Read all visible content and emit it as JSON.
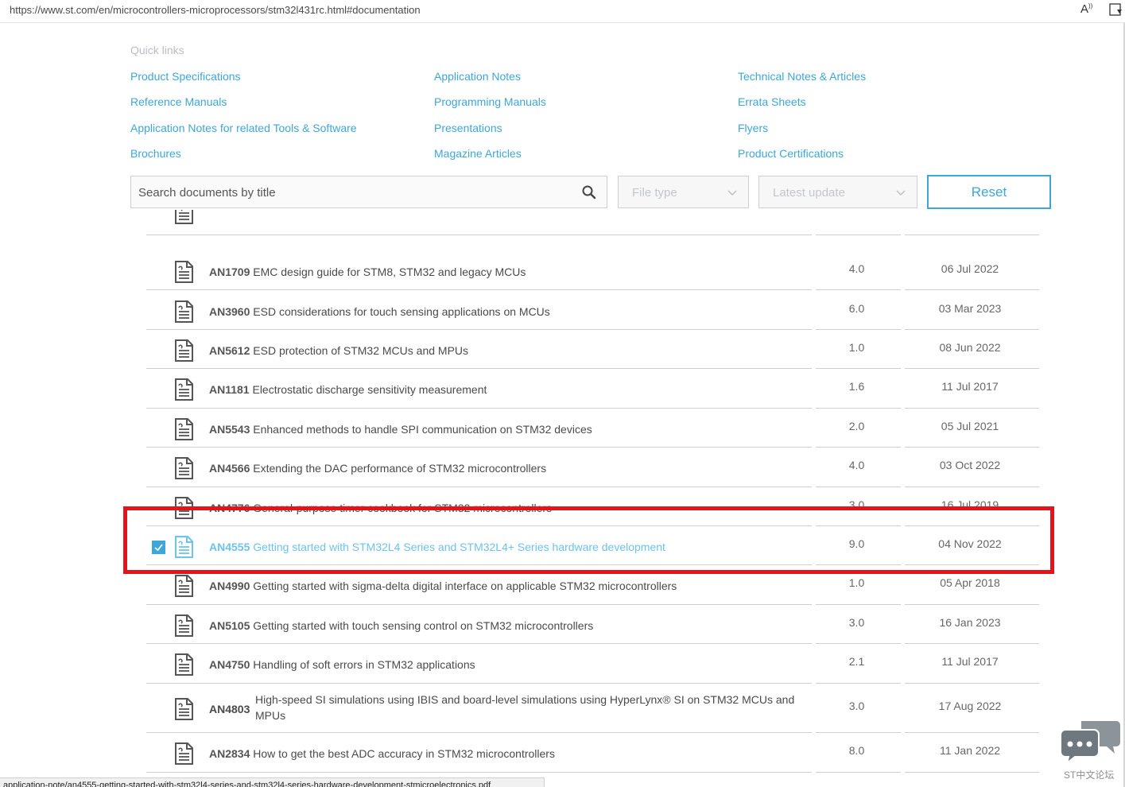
{
  "browser": {
    "url": "https://www.st.com/en/microcontrollers-microprocessors/stm32l431rc.html#documentation",
    "read_aloud_icon": "read-aloud-icon",
    "reader_icon": "reader-view-icon"
  },
  "quick_links": {
    "title": "Quick links",
    "col1": [
      "Product Specifications",
      "Reference Manuals",
      "Application Notes for related Tools & Software",
      "Brochures"
    ],
    "col2": [
      "Application Notes",
      "Programming Manuals",
      "Presentations",
      "Magazine Articles"
    ],
    "col3": [
      "Technical Notes & Articles",
      "Errata Sheets",
      "Flyers",
      "Product Certifications"
    ]
  },
  "filters": {
    "search_placeholder": "Search documents by title",
    "file_type": "File type",
    "latest_update": "Latest update",
    "reset": "Reset"
  },
  "documents": [
    {
      "code": "AN1709",
      "title": "EMC design guide for STM8, STM32 and legacy MCUs",
      "version": "4.0",
      "date": "06 Jul 2022"
    },
    {
      "code": "AN3960",
      "title": "ESD considerations for touch sensing applications on MCUs",
      "version": "6.0",
      "date": "03 Mar 2023"
    },
    {
      "code": "AN5612",
      "title": "ESD protection of STM32 MCUs and MPUs",
      "version": "1.0",
      "date": "08 Jun 2022"
    },
    {
      "code": "AN1181",
      "title": "Electrostatic discharge sensitivity measurement",
      "version": "1.6",
      "date": "11 Jul 2017"
    },
    {
      "code": "AN5543",
      "title": "Enhanced methods to handle SPI communication on STM32 devices",
      "version": "2.0",
      "date": "05 Jul 2021"
    },
    {
      "code": "AN4566",
      "title": "Extending the DAC performance of STM32 microcontrollers",
      "version": "4.0",
      "date": "03 Oct 2022"
    },
    {
      "code": "AN4776",
      "title": "General-purpose timer cookbook for STM32 microcontrollers",
      "version": "3.0",
      "date": "16 Jul 2019"
    },
    {
      "code": "AN4555",
      "title": "Getting started with STM32L4 Series and STM32L4+ Series hardware development",
      "version": "9.0",
      "date": "04 Nov 2022",
      "selected": true
    },
    {
      "code": "AN4990",
      "title": "Getting started with sigma-delta digital interface on applicable STM32 microcontrollers",
      "version": "1.0",
      "date": "05 Apr 2018"
    },
    {
      "code": "AN5105",
      "title": "Getting started with touch sensing control on STM32 microcontrollers",
      "version": "3.0",
      "date": "16 Jan 2023"
    },
    {
      "code": "AN4750",
      "title": "Handling of soft errors in STM32 applications",
      "version": "2.1",
      "date": "11 Jul 2017"
    },
    {
      "code": "AN4803",
      "title": "High-speed SI simulations using IBIS and board-level simulations using HyperLynx® SI on STM32 MCUs and MPUs",
      "version": "3.0",
      "date": "17 Aug 2022"
    },
    {
      "code": "AN2834",
      "title": "How to get the best ADC accuracy in STM32 microcontrollers",
      "version": "8.0",
      "date": "11 Jan 2022"
    }
  ],
  "status_bar": "application-note/an4555-getting-started-with-stm32l4-series-and-stm32l4-series-hardware-development-stmicroelectronics.pdf",
  "forum": {
    "label": "ST中文论坛"
  },
  "colors": {
    "link": "#3ca7d8",
    "highlight": "#e3141c",
    "selected_text": "#6cc3ee"
  }
}
